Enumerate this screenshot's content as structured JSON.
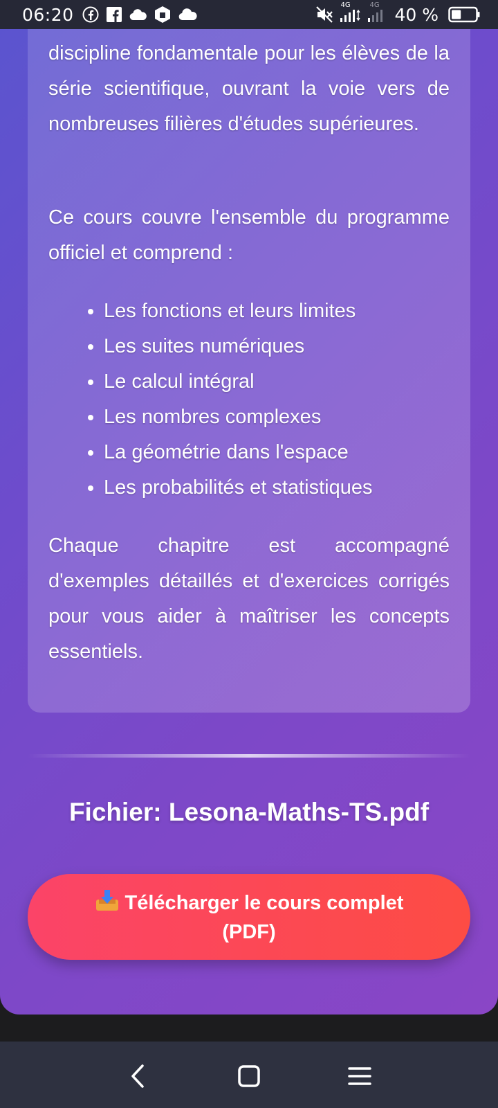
{
  "status_bar": {
    "time": "06:20",
    "battery_percent": "40 %",
    "battery_level": 0.4,
    "network_label_1": "4G",
    "network_label_2": "4G",
    "icons": [
      "facebook-icon",
      "facebook-square-icon",
      "cloud-icon",
      "hexagon-app-icon",
      "cloud-icon",
      "mute-icon",
      "signal-icon",
      "signal-weak-icon",
      "battery-icon"
    ]
  },
  "content": {
    "paragraph_1": "discipline fondamentale pour les élèves de la série scientifique, ouvrant la voie vers de nombreuses filières d'études supérieures.",
    "paragraph_2": "Ce cours couvre l'ensemble du programme officiel et comprend :",
    "topics": [
      "Les fonctions et leurs limites",
      "Les suites numériques",
      "Le calcul intégral",
      "Les nombres complexes",
      "La géométrie dans l'espace",
      "Les probabilités et statistiques"
    ],
    "paragraph_3": "Chaque chapitre est accompagné d'exemples détaillés et d'exercices corrigés pour vous aider à maîtriser les concepts essentiels."
  },
  "file": {
    "label": "Fichier: Lesona-Maths-TS.pdf"
  },
  "download": {
    "label": "Télécharger le cours complet (PDF)",
    "icon": "download-tray-icon"
  },
  "nav": {
    "icons": [
      "back-icon",
      "home-icon",
      "menu-icon"
    ]
  },
  "colors": {
    "gradient_start": "#5a55cf",
    "gradient_end": "#8a46c6",
    "button_start": "#fb4468",
    "button_end": "#fd4c44"
  }
}
